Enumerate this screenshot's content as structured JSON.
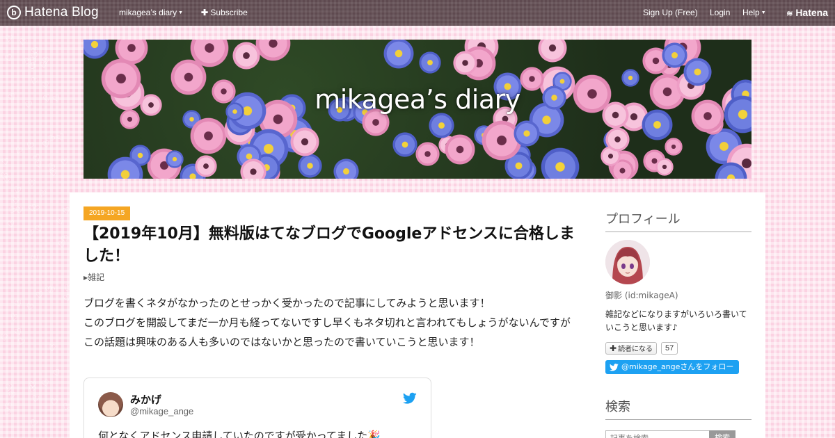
{
  "topbar": {
    "logo_text": "Hatena Blog",
    "logo_mark": "b",
    "blog_menu": "mikagea’s diary",
    "subscribe": "Subscribe",
    "signup": "Sign Up (Free)",
    "login": "Login",
    "help": "Help",
    "brand": "Hatena"
  },
  "header": {
    "blog_title": "mikagea’s diary"
  },
  "entry": {
    "date": "2019-10-15",
    "title": "【2019年10月】無料版はてなブログでGoogleアドセンスに合格しました！",
    "category": "雑記",
    "paragraphs": [
      "ブログを書くネタがなかったのとせっかく受かったので記事にしてみようと思います！",
      "このブログを開設してまだ一か月も経ってないですし早くもネタ切れと言われてもしょうがないんですがこの話題は興味のある人も多いのではないかと思ったので書いていこうと思います！"
    ],
    "tweet": {
      "name": "みかげ",
      "handle": "@mikage_ange",
      "text": "何となくアドセンス申請していたのですが受かってました🎉"
    }
  },
  "sidebar": {
    "profile_heading": "プロフィール",
    "profile_name": "御影 (id:mikageA)",
    "profile_desc": "雑記などになりますがいろいろ書いていこうと思います♪",
    "reader_button": "読者になる",
    "reader_count": "57",
    "follow_button": "@mikage_angeさんをフォロー",
    "search_heading": "検索",
    "search_placeholder": "記事を検索",
    "search_button": "検索"
  },
  "colors": {
    "topbar": "#5f4a50",
    "date_badge": "#f5a623",
    "twitter": "#1da1f2",
    "background_pink": "#fbd2e2"
  },
  "icons": [
    "hatena-logo-icon",
    "plus-icon",
    "chevron-down-icon",
    "twitter-bird-icon",
    "hatena-brand-icon"
  ]
}
